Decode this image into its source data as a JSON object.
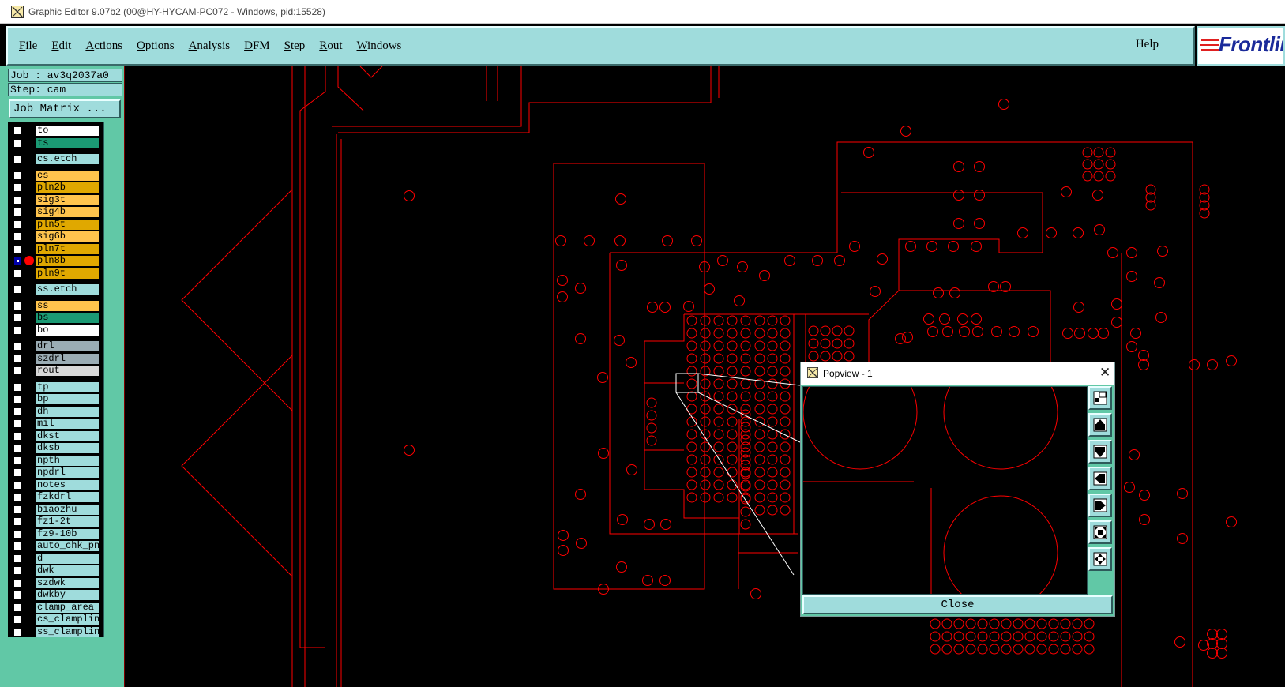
{
  "window": {
    "title": "Graphic Editor 9.07b2 (00@HY-HYCAM-PC072 - Windows, pid:15528)"
  },
  "menubar": {
    "items": [
      {
        "u": "F",
        "rest": "ile"
      },
      {
        "u": "E",
        "rest": "dit"
      },
      {
        "u": "A",
        "rest": "ctions"
      },
      {
        "u": "O",
        "rest": "ptions"
      },
      {
        "u": "A",
        "rest": "nalysis"
      },
      {
        "u": "D",
        "rest": "FM"
      },
      {
        "u": "S",
        "rest": "tep"
      },
      {
        "u": "R",
        "rest": "out"
      },
      {
        "u": "W",
        "rest": "indows"
      }
    ],
    "help": "Help",
    "logo": "Frontline"
  },
  "job": {
    "job_label": "Job : av3q2037a0",
    "step_label": "Step: cam",
    "matrix_button": "Job Matrix ..."
  },
  "layers": [
    {
      "name": "to",
      "color": "#ffffff"
    },
    {
      "name": "ts",
      "color": "#1b9a74"
    },
    {
      "name": "cs.etch",
      "color": "#9fdcdc"
    },
    {
      "name": "cs",
      "color": "#ffc44d"
    },
    {
      "name": "pln2b",
      "color": "#e0a800"
    },
    {
      "name": "sig3t",
      "color": "#ffc44d"
    },
    {
      "name": "sig4b",
      "color": "#ffc44d"
    },
    {
      "name": "pln5t",
      "color": "#e0a800"
    },
    {
      "name": "sig6b",
      "color": "#ffc44d"
    },
    {
      "name": "pln7t",
      "color": "#e0a800"
    },
    {
      "name": "pln8b",
      "color": "#e0a800",
      "selected": true
    },
    {
      "name": "pln9t",
      "color": "#e0a800"
    },
    {
      "name": "ss.etch",
      "color": "#9fdcdc"
    },
    {
      "name": "ss",
      "color": "#ffc44d"
    },
    {
      "name": "bs",
      "color": "#1b9a74"
    },
    {
      "name": "bo",
      "color": "#ffffff"
    },
    {
      "name": "drl",
      "color": "#9aacb4"
    },
    {
      "name": "szdrl",
      "color": "#9aacb4"
    },
    {
      "name": "rout",
      "color": "#d8d8d8"
    },
    {
      "name": "tp",
      "color": "#9fdcdc"
    },
    {
      "name": "bp",
      "color": "#9fdcdc"
    },
    {
      "name": "dh",
      "color": "#9fdcdc"
    },
    {
      "name": "mil",
      "color": "#9fdcdc"
    },
    {
      "name": "dkst",
      "color": "#9fdcdc"
    },
    {
      "name": "dksb",
      "color": "#9fdcdc"
    },
    {
      "name": "npth",
      "color": "#9fdcdc"
    },
    {
      "name": "npdrl",
      "color": "#9fdcdc"
    },
    {
      "name": "notes",
      "color": "#9fdcdc"
    },
    {
      "name": "fzkdrl",
      "color": "#9fdcdc"
    },
    {
      "name": "biaozhu",
      "color": "#9fdcdc"
    },
    {
      "name": "fz1-2t",
      "color": "#9fdcdc"
    },
    {
      "name": "fz9-10b",
      "color": "#9fdcdc"
    },
    {
      "name": "auto_chk_pnl",
      "color": "#9fdcdc"
    },
    {
      "name": "d",
      "color": "#9fdcdc"
    },
    {
      "name": "dwk",
      "color": "#9fdcdc"
    },
    {
      "name": "szdwk",
      "color": "#9fdcdc"
    },
    {
      "name": "dwkby",
      "color": "#9fdcdc"
    },
    {
      "name": "clamp_area",
      "color": "#9fdcdc"
    },
    {
      "name": "cs_clampline",
      "color": "#9fdcdc"
    },
    {
      "name": "ss_clampline",
      "color": "#9fdcdc"
    }
  ],
  "popview": {
    "title": "Popview - 1",
    "close_label": "Close"
  },
  "colors": {
    "feature": "#ff0000",
    "panel": "#61c8a6",
    "button": "#9fdcdc"
  }
}
